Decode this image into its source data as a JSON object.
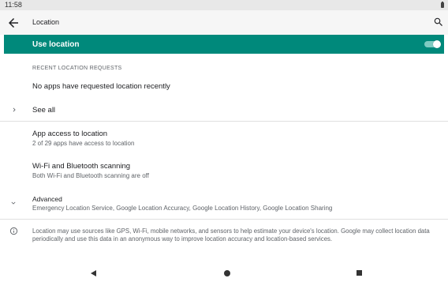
{
  "status_bar": {
    "time": "11:58"
  },
  "app_bar": {
    "title": "Location"
  },
  "master_switch": {
    "label": "Use location",
    "enabled": true
  },
  "recent_requests": {
    "header": "RECENT LOCATION REQUESTS",
    "empty_message": "No apps have requested location recently",
    "see_all_label": "See all"
  },
  "preferences": [
    {
      "title": "App access to location",
      "summary": "2 of 29 apps have access to location"
    },
    {
      "title": "Wi-Fi and Bluetooth scanning",
      "summary": "Both Wi-Fi and Bluetooth scanning are off"
    },
    {
      "title": "Advanced",
      "summary": "Emergency Location Service, Google Location Accuracy, Google Location History, Google Location Sharing"
    }
  ],
  "footer": {
    "text": "Location may use sources like GPS, Wi-Fi, mobile networks, and sensors to help estimate your device's location. Google may collect location data periodically and use this data in an anonymous way to improve location accuracy and location-based services."
  },
  "icons": {
    "back": "arrow-left-icon",
    "search": "search-icon",
    "see_all": "chevron-right-icon",
    "advanced": "chevron-down-icon",
    "info": "info-icon"
  },
  "colors": {
    "accent": "#00897b",
    "toggle_track": "#7fcbc2"
  }
}
